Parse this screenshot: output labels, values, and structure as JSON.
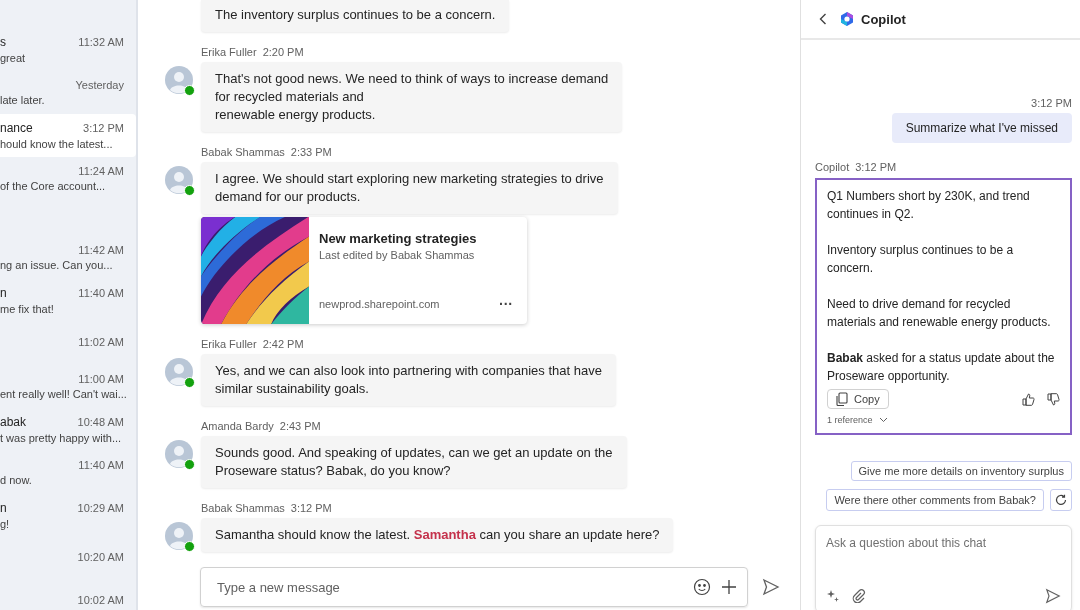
{
  "chat_list": [
    {
      "name": "s",
      "time": "11:32 AM",
      "preview": "great",
      "selected": false
    },
    {
      "time": "Yesterday",
      "preview": "late later.",
      "selected": false
    },
    {
      "name": "nance",
      "time": "3:12 PM",
      "preview": "hould know the latest...",
      "selected": true
    },
    {
      "time": "11:24 AM",
      "preview": "of the Core account...",
      "selected": false
    },
    {
      "time": "11:42 AM",
      "preview": "ng an issue. Can you...",
      "selected": false
    },
    {
      "name": "n",
      "time": "11:40 AM",
      "preview": "me fix that!",
      "selected": false
    },
    {
      "time": "11:02 AM",
      "selected": false
    },
    {
      "time": "11:00 AM",
      "preview": "ent really well! Can't wai...",
      "selected": false
    },
    {
      "name": "abak",
      "time": "10:48 AM",
      "preview": "t was pretty happy with...",
      "selected": false
    },
    {
      "time": "11:40 AM",
      "preview": "d now.",
      "selected": false
    },
    {
      "name": "n",
      "time": "10:29 AM",
      "preview": "g!",
      "selected": false
    },
    {
      "time": "10:20 AM",
      "selected": false
    },
    {
      "time": "10:02 AM",
      "selected": false
    }
  ],
  "messages": [
    {
      "text": "The inventory surplus continues to be a concern."
    },
    {
      "author": "Erika Fuller",
      "time": "2:20 PM",
      "text": "That's not good news. We need to think of ways to increase demand\nfor recycled materials and\nrenewable energy products.",
      "online": true
    },
    {
      "author": "Babak Shammas",
      "time": "2:33 PM",
      "text": "I agree. We should start exploring new marketing strategies to drive\ndemand for our products.",
      "online": true,
      "attachment": {
        "kind": "picture",
        "title": "New marketing strategies",
        "subtitle": "Last edited by Babak Shammas",
        "domain": "newprod.sharepoint.com",
        "more": "···"
      }
    },
    {
      "author": "Erika Fuller",
      "time": "2:42 PM",
      "text": "Yes, and we can also look into partnering with companies that have\nsimilar sustainability goals.",
      "online": true
    },
    {
      "author": "Amanda Bardy",
      "time": "2:43 PM",
      "text": "Sounds good. And speaking of updates, can we get an update on the\nProseware status? Babak, do you know?",
      "online": true
    },
    {
      "author": "Babak Shammas",
      "time": "3:12 PM",
      "text": "Samantha should know the latest. **Samantha** can you share an update here?",
      "online": true
    }
  ],
  "composer": {
    "placeholder": "Type a new message"
  },
  "copilot": {
    "title": "Copilot",
    "user_time": "3:12 PM",
    "user_prompt": "Summarize what I've missed",
    "reply_author": "Copilot",
    "reply_time": "3:12 PM",
    "reply_paragraphs": [
      "Q1 Numbers short by 230K, and trend continues in Q2.",
      "Inventory surplus continues to be a concern.",
      "Need to drive demand for recycled materials and renewable energy products.",
      "**Babak** asked for a status update about the Proseware opportunity."
    ],
    "copy_label": "Copy",
    "references": "1 reference",
    "suggestions": [
      "Give me more details on inventory surplus",
      "Were there other comments from Babak?"
    ],
    "input_placeholder": "Ask a question about this chat"
  }
}
